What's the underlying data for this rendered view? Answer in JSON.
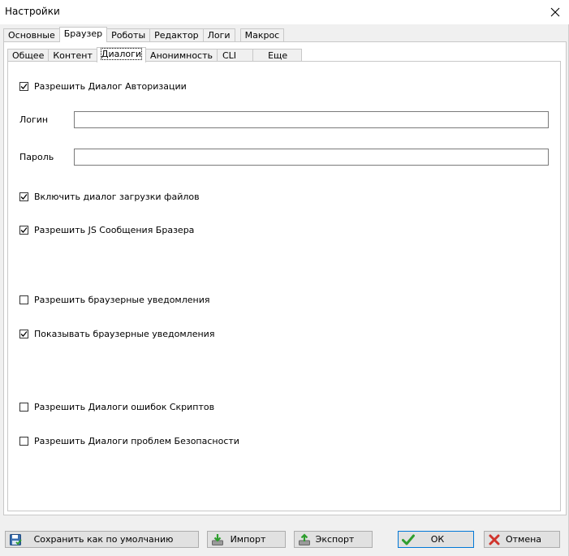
{
  "window": {
    "title": "Настройки"
  },
  "main_tabs": [
    {
      "label": "Основные"
    },
    {
      "label": "Браузер"
    },
    {
      "label": "Роботы"
    },
    {
      "label": "Редактор"
    },
    {
      "label": "Логи"
    },
    {
      "label": "Макрос"
    }
  ],
  "sub_tabs": [
    {
      "label": "Общее"
    },
    {
      "label": "Контент"
    },
    {
      "label": "Диалоги"
    },
    {
      "label": "Анонимность"
    },
    {
      "label": "CLI"
    },
    {
      "label": "Еще"
    }
  ],
  "active_main_tab": "Браузер",
  "active_sub_tab": "Диалоги",
  "dialogs": {
    "allow_auth": {
      "label": "Разрешить Диалог Авторизации",
      "checked": true
    },
    "login": {
      "label": "Логин",
      "value": ""
    },
    "password": {
      "label": "Пароль",
      "value": ""
    },
    "download_dialog": {
      "label": "Включить диалог загрузки файлов",
      "checked": true
    },
    "js_messages": {
      "label": "Разрешить JS Сообщения Бразера",
      "checked": true
    },
    "allow_notifications": {
      "label": "Разрешить браузерные уведомления",
      "checked": false
    },
    "show_notifications": {
      "label": "Показывать браузерные уведомления",
      "checked": true
    },
    "script_errors": {
      "label": "Разрешить Диалоги ошибок Скриптов",
      "checked": false
    },
    "security_problems": {
      "label": "Разрешить Диалоги проблем Безопасности",
      "checked": false
    }
  },
  "buttons": {
    "save_default": "Сохранить как по умолчанию",
    "import": "Импорт",
    "export": "Экспорт",
    "ok": "ОК",
    "cancel": "Отмена"
  },
  "colors": {
    "accent": "#0078d7",
    "ok_green": "#2e9e2e",
    "cancel_red": "#d0342c"
  }
}
